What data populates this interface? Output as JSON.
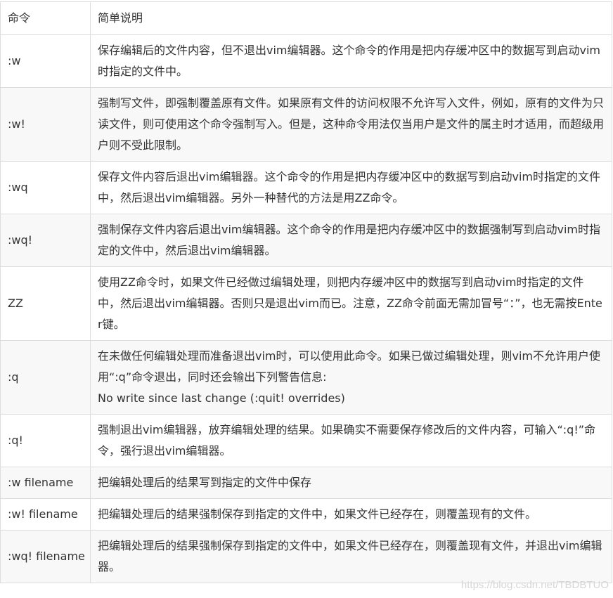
{
  "table": {
    "header": {
      "command": "命令",
      "description": "简单说明"
    },
    "rows": [
      {
        "command": ":w",
        "description": "保存编辑后的文件内容，但不退出vim编辑器。这个命令的作用是把内存缓冲区中的数据写到启动vim时指定的文件中。"
      },
      {
        "command": ":w!",
        "description": "强制写文件，即强制覆盖原有文件。如果原有文件的访问权限不允许写入文件，例如，原有的文件为只读文件，则可使用这个命令强制写入。但是，这种命令用法仅当用户是文件的属主时才适用，而超级用户则不受此限制。"
      },
      {
        "command": ":wq",
        "description": "保存文件内容后退出vim编辑器。这个命令的作用是把内存缓冲区中的数据写到启动vim时指定的文件中，然后退出vim编辑器。另外一种替代的方法是用ZZ命令。"
      },
      {
        "command": ":wq!",
        "description": "强制保存文件内容后退出vim编辑器。这个命令的作用是把内存缓冲区中的数据强制写到启动vim时指定的文件中，然后退出vim编辑器。"
      },
      {
        "command": "ZZ",
        "description": "使用ZZ命令时，如果文件已经做过编辑处理，则把内存缓冲区中的数据写到启动vim时指定的文件中，然后退出vim编辑器。否则只是退出vim而已。注意，ZZ命令前面无需加冒号“：”，也无需按Enter键。"
      },
      {
        "command": ":q",
        "description": "在未做任何编辑处理而准备退出vim时，可以使用此命令。如果已做过编辑处理，则vim不允许用户使用“:q”命令退出，同时还会输出下列警告信息:",
        "extra": "No write since last change (:quit! overrides)"
      },
      {
        "command": ":q!",
        "description": "强制退出vim编辑器，放弃编辑处理的结果。如果确实不需要保存修改后的文件内容，可输入“:q!”命令，强行退出vim编辑器。"
      },
      {
        "command": ":w filename",
        "description": "把编辑处理后的结果写到指定的文件中保存"
      },
      {
        "command": ":w! filename",
        "description": "把编辑处理后的结果强制保存到指定的文件中，如果文件已经存在，则覆盖现有的文件。"
      },
      {
        "command": ":wq! filename",
        "description": "把编辑处理后的结果强制保存到指定的文件中，如果文件已经存在，则覆盖现有文件，并退出vim编辑器。"
      }
    ]
  },
  "watermark": "https://blog.csdn.net/TBDBTUO"
}
